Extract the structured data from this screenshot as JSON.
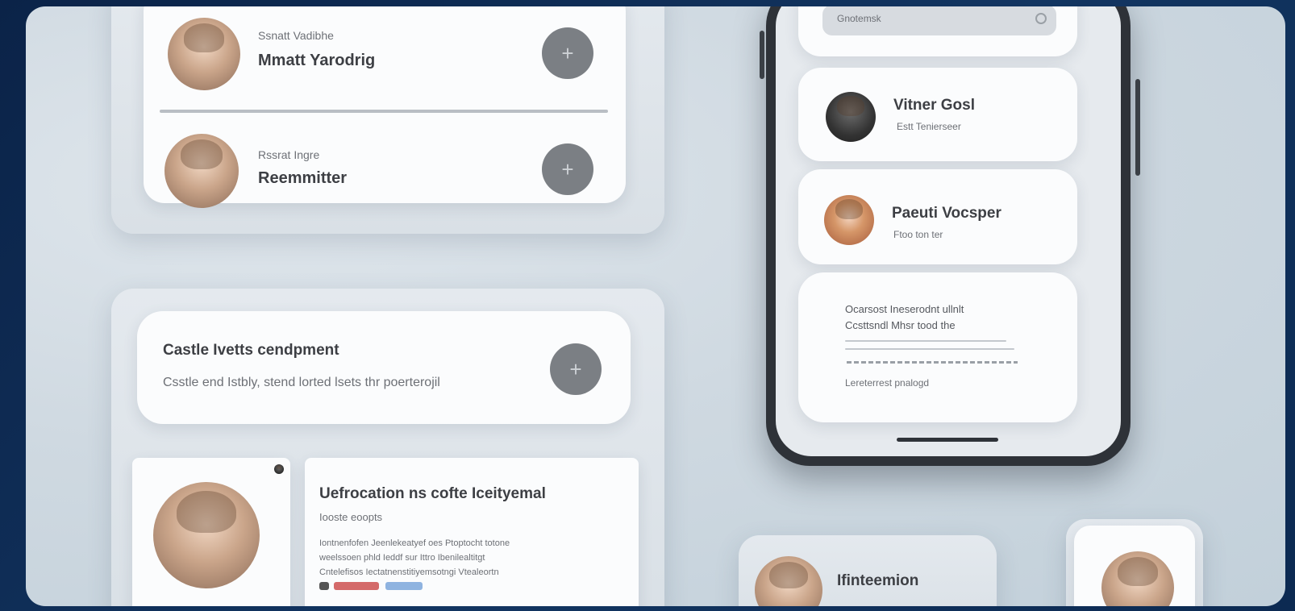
{
  "contacts_panel": {
    "items": [
      {
        "subtitle": "Ssnatt Vadibhe",
        "name": "Mmatt Yarodrig"
      },
      {
        "subtitle": "Rssrat Ingre",
        "name": "Reemmitter"
      }
    ],
    "add_icon": "plus-icon"
  },
  "invite_panel": {
    "card_title": "Castle Ivetts cendpment",
    "card_body": "Csstle end Istbly, stend lorted lsets thr poerterojil",
    "profile": {
      "title": "Uefrocation ns cofte Iceityemal",
      "subtitle": "Iooste eoopts",
      "body_lines": [
        "Iontnenfofen Jeenlekeatyef oes Ptoptocht totone",
        "weelssoen phld Ieddf sur Ittro Ibenilealtitgt",
        "Cntelefisos Iectatnenstitiyemsotngi Vtealeortn"
      ]
    }
  },
  "phone": {
    "search_placeholder": "Gnotemsk",
    "list": [
      {
        "name": "Vitner Gosl",
        "subtitle": "Estt Tenierseer"
      },
      {
        "name": "Paeuti Vocsper",
        "subtitle": "Ftoo ton ter"
      }
    ],
    "note": {
      "line1": "Ocarsost Ineserodnt ullnlt",
      "line2": "Ccsttsndl Mhsr tood the",
      "footer": "Lereterrest pnalogd"
    }
  },
  "bottom_cards": [
    {
      "name": "Ifinteemion"
    }
  ],
  "colors": {
    "background": "#0b2348",
    "canvas": "#d3dce4",
    "card": "#fbfcfd",
    "plus_button": "#7b7f84",
    "phone_frame": "#2e3238"
  }
}
